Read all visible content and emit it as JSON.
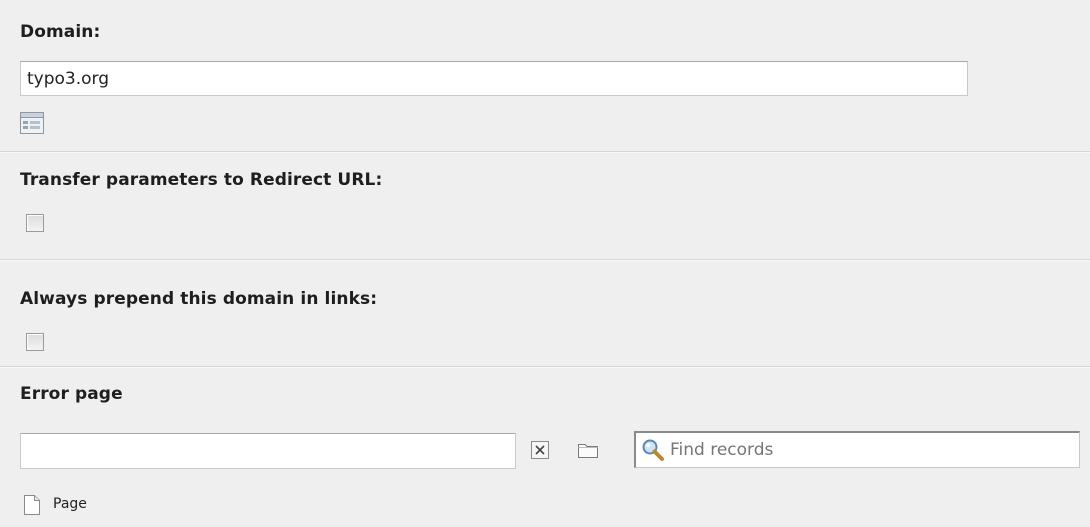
{
  "domain_section": {
    "label": "Domain:",
    "value": "typo3.org"
  },
  "transfer_section": {
    "label": "Transfer parameters to Redirect URL:",
    "checked": false
  },
  "prepend_section": {
    "label": "Always prepend this domain in links:",
    "checked": false
  },
  "error_page_section": {
    "label": "Error page",
    "value": "",
    "find_placeholder": "Find records",
    "record_type_label": "Page"
  },
  "icons": {
    "wizard": "list-wizard-icon",
    "remove": "remove-x-icon",
    "browse": "folder-icon",
    "search": "magnifier-icon",
    "page": "page-icon"
  }
}
